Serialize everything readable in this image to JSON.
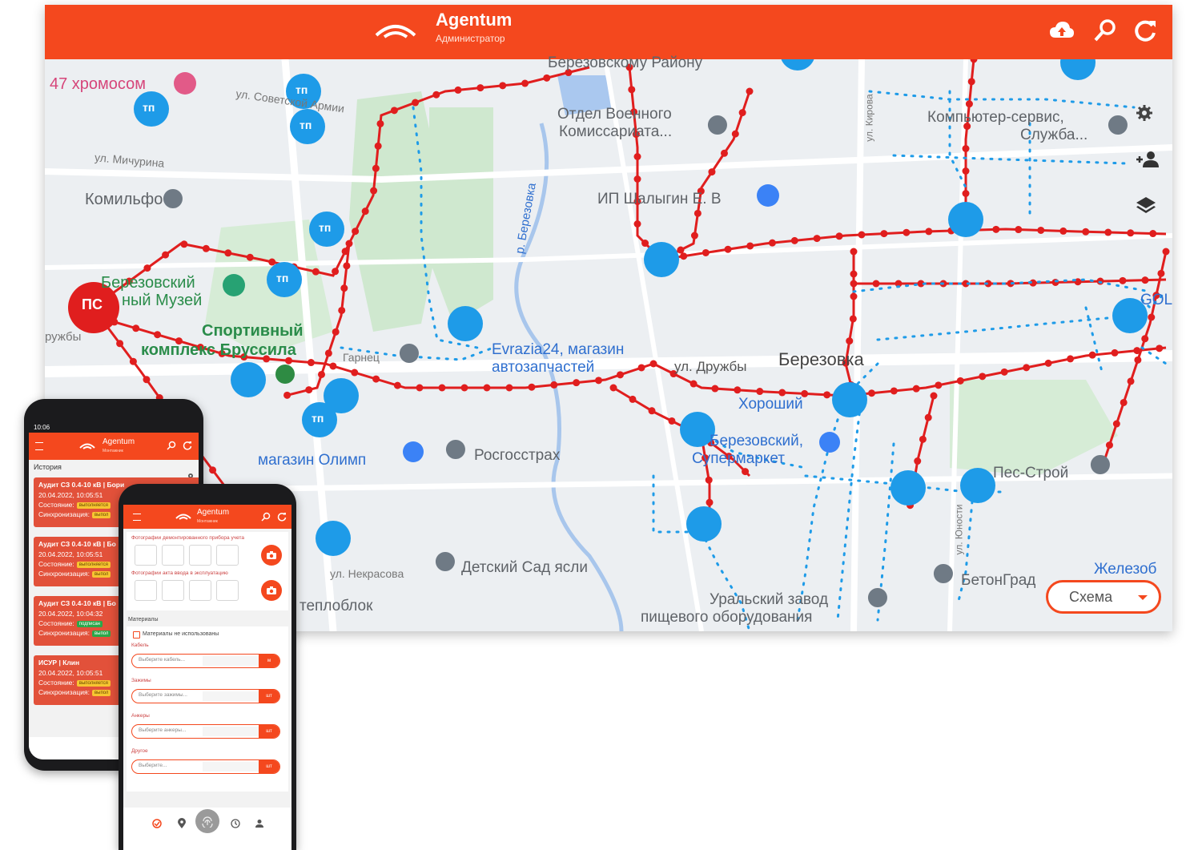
{
  "desktop": {
    "app_title": "Agentum",
    "app_subtitle": "Администратор",
    "schema_select": "Схема",
    "map_labels": {
      "l1": "47 хромосом",
      "l2": "ул. Советской Армии",
      "l3": "ул. Мичурина",
      "l4": "Комильфо",
      "l5": "Березовский",
      "l6": "ный Музей",
      "l7": "ружбы",
      "l8": "Спортивный",
      "l9": "комплекс Бруссила",
      "l10": "Отдел Военного",
      "l11": "Комиссариата...",
      "l12": "ИП Шалыгин Е. В",
      "l13": "Березовскому Району",
      "l14": "Компьютер-сервис,",
      "l15": "Служба...",
      "l16": "Evrazia24, магазин",
      "l17": "автозапчастей",
      "l18": "ул. Дружбы",
      "l19": "Березовка",
      "l20": "Хороший",
      "l21": "Березовский,",
      "l22": "Супермаркет",
      "l23": "магазин Олимп",
      "l24": "Росгосстрах",
      "l25": "Пес-Строй",
      "l26": "ул. Некрасова",
      "l27": "Детский Сад ясли",
      "l28": "БетонГрад",
      "l29": "Железоб",
      "l30": "теплоблок",
      "l31": "Уральский завод",
      "l32": "пищевого оборудования",
      "l33": "р. Березовка",
      "l34": "ул. Кирова",
      "l35": "ул. Юности",
      "l36": "GOL",
      "l37": "Гарнец"
    },
    "ps_marker": "ПС",
    "tp_marker": "тп",
    "icons": {
      "upload": "cloud-upload-icon",
      "search": "search-icon",
      "refresh": "refresh-icon",
      "settings": "gear-icon",
      "add_user": "add-user-icon",
      "layers": "layers-icon"
    }
  },
  "phone1": {
    "time": "10:06",
    "app_title": "Agentum",
    "app_subtitle": "Монтажник",
    "section": "История",
    "cards": [
      {
        "title": "Аудит СЗ 0.4-10 кВ | Бори",
        "date": "20.04.2022, 10:05:51",
        "state_label": "Состояние:",
        "state": "выполняется",
        "sync_label": "Синхронизация:",
        "sync": "выпол"
      },
      {
        "title": "Аудит СЗ 0.4-10 кВ | Бо",
        "date": "20.04.2022, 10:05:51",
        "state_label": "Состояние:",
        "state": "выполняется",
        "sync_label": "Синхронизация:",
        "sync": "выпол"
      },
      {
        "title": "Аудит СЗ 0.4-10 кВ | Бо",
        "date": "20.04.2022, 10:04:32",
        "state_label": "Состояние:",
        "state": "подписан",
        "sync_label": "Синхронизация:",
        "sync": "выпол"
      },
      {
        "title": "ИСУР | Клин",
        "date": "20.04.2022, 10:05:51",
        "state_label": "Состояние:",
        "state": "выполняется",
        "sync_label": "Синхронизация:",
        "sync": "выпол"
      }
    ]
  },
  "phone2": {
    "app_title": "Agentum",
    "app_subtitle": "Монтажник",
    "photo_label_1": "Фотографии демонтированного прибора учета",
    "photo_label_2": "Фотографии акта ввода в эксплуатацию",
    "materials_header": "Материалы",
    "materials_checkbox": "Материалы не использованы",
    "groups": [
      {
        "label": "Кабель",
        "placeholder": "Выберите кабель...",
        "unit": "м"
      },
      {
        "label": "Зажимы",
        "placeholder": "Выберите зажимы...",
        "unit": "шт"
      },
      {
        "label": "Анкеры",
        "placeholder": "Выберите анкеры...",
        "unit": "шт"
      },
      {
        "label": "Другое",
        "placeholder": "Выберите...",
        "unit": "шт"
      }
    ]
  },
  "colors": {
    "brand": "#f4481e",
    "blue_line": "#1e9be8",
    "red_line": "#e01e1e",
    "map_green": "#cde8cd"
  }
}
